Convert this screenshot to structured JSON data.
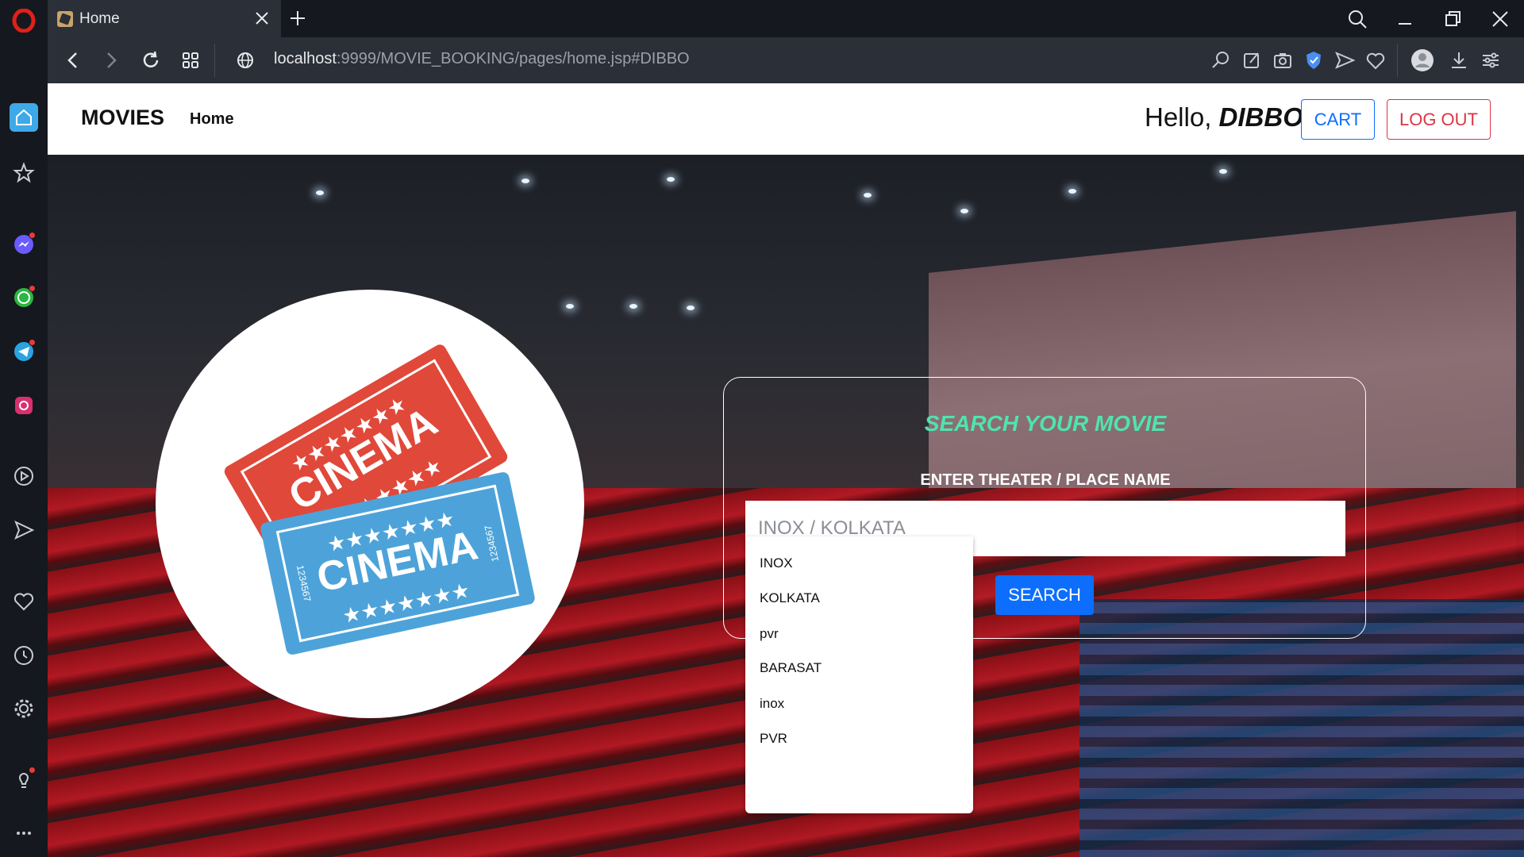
{
  "browser": {
    "tab_title": "Home",
    "url_host": "localhost",
    "url_path": ":9999/MOVIE_BOOKING/pages/home.jsp#DIBBO"
  },
  "sidebar": {
    "items": [
      {
        "icon": "home-icon"
      },
      {
        "icon": "star-icon"
      },
      {
        "icon": "messenger-icon"
      },
      {
        "icon": "whatsapp-icon"
      },
      {
        "icon": "telegram-icon"
      },
      {
        "icon": "instagram-icon"
      },
      {
        "icon": "player-icon"
      },
      {
        "icon": "send-icon"
      },
      {
        "icon": "heart-icon"
      },
      {
        "icon": "history-icon"
      },
      {
        "icon": "settings-icon"
      },
      {
        "icon": "lightbulb-icon"
      },
      {
        "icon": "more-icon"
      }
    ]
  },
  "navbar": {
    "brand": "MOVIES",
    "home_link": "Home",
    "greeting": "Hello,",
    "username": "DIBBO",
    "cart_label": "CART",
    "logout_label": "LOG OUT"
  },
  "logo": {
    "ticket_red_text": "CINEMA",
    "ticket_blue_text": "CINEMA",
    "ticket_number": "1234567"
  },
  "search": {
    "title": "SEARCH YOUR MOVIE",
    "label": "ENTER THEATER / PLACE NAME",
    "placeholder": "INOX / KOLKATA",
    "button_label": "SEARCH"
  },
  "suggestions": [
    "INOX",
    "KOLKATA",
    "pvr",
    "BARASAT",
    "inox",
    "PVR"
  ],
  "colors": {
    "primary": "#0d6efd",
    "danger": "#dc3545",
    "accent_title": "#4fe3b0",
    "opera_red": "#e0201a",
    "ticket_red": "#e0483a",
    "ticket_blue": "#4da3d9"
  }
}
